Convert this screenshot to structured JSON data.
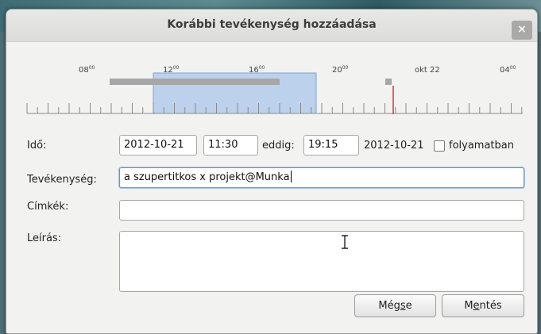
{
  "window": {
    "title": "Korábbi tevékenység hozzáadása",
    "close_glyph": "×"
  },
  "timeline": {
    "ticks": [
      {
        "hour": "08",
        "sup": "00"
      },
      {
        "hour": "12",
        "sup": "00"
      },
      {
        "hour": "16",
        "sup": "00"
      },
      {
        "hour": "20",
        "sup": "00"
      },
      {
        "hour": "okt 22",
        "sup": ""
      },
      {
        "hour": "04",
        "sup": "00"
      }
    ],
    "selection_color": "#a9c5ea",
    "activity_bar_color": "#a7a7a7",
    "now_line_color": "#e03030"
  },
  "form": {
    "time_label": "Idő:",
    "start_date": "2012-10-21",
    "start_time": "11:30",
    "until_label": "eddig:",
    "end_time": "19:15",
    "end_date": "2012-10-21",
    "ongoing_label": "folyamatban",
    "activity_label": "Tevékenység:",
    "activity_value": "a szupertitkos x projekt@Munka",
    "tags_label": "Címkék:",
    "tags_value": "",
    "description_label": "Leírás:",
    "description_value": ""
  },
  "buttons": {
    "cancel_pre": "Még",
    "cancel_u": "s",
    "cancel_post": "e",
    "save_pre": "M",
    "save_u": "e",
    "save_post": "ntés"
  }
}
